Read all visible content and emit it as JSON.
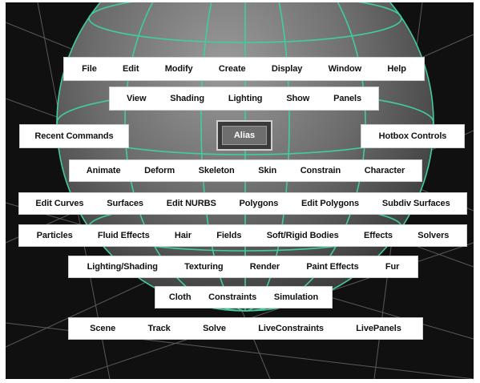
{
  "hotbox": {
    "rows": [
      {
        "items": [
          "File",
          "Edit",
          "Modify",
          "Create",
          "Display",
          "Window",
          "Help"
        ]
      },
      {
        "items": [
          "View",
          "Shading",
          "Lighting",
          "Show",
          "Panels"
        ]
      },
      {
        "items": [
          "Recent Commands"
        ]
      },
      {
        "items": [
          "Hotbox Controls"
        ]
      },
      {
        "items": [
          "Animate",
          "Deform",
          "Skeleton",
          "Skin",
          "Constrain",
          "Character"
        ]
      },
      {
        "items": [
          "Edit Curves",
          "Surfaces",
          "Edit NURBS",
          "Polygons",
          "Edit Polygons",
          "Subdiv Surfaces"
        ]
      },
      {
        "items": [
          "Particles",
          "Fluid Effects",
          "Hair",
          "Fields",
          "Soft/Rigid Bodies",
          "Effects",
          "Solvers"
        ]
      },
      {
        "items": [
          "Lighting/Shading",
          "Texturing",
          "Render",
          "Paint Effects",
          "Fur"
        ]
      },
      {
        "items": [
          "Cloth",
          "Constraints",
          "Simulation"
        ]
      },
      {
        "items": [
          "Scene",
          "Track",
          "Solve",
          "LiveConstraints",
          "LivePanels"
        ]
      }
    ],
    "center_label": "Alias"
  },
  "colors": {
    "background": "#101010",
    "menu_row": "#ffffff",
    "wireframe": "#3fcf9a",
    "grid": "#5a5a5a"
  }
}
